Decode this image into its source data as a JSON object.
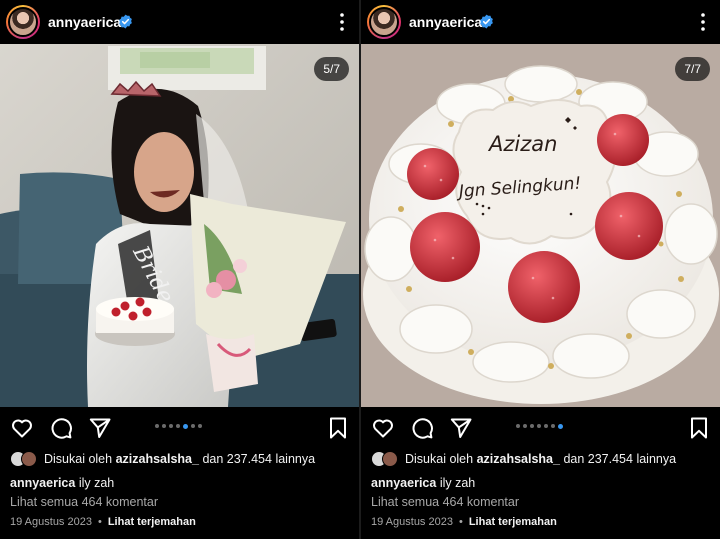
{
  "posts": [
    {
      "username": "annyaerica",
      "counter": "5/7",
      "liked_by_prefix": "Disukai oleh",
      "liked_by_user": "azizahsalsha_",
      "liked_by_suffix": "dan 237.454 lainnya",
      "caption_user": "annyaerica",
      "caption_text": "ily zah",
      "view_comments": "Lihat semua 464 komentar",
      "date": "19 Agustus 2023",
      "separator": "•",
      "translate": "Lihat terjemahan",
      "photo_text": "Bride",
      "carousel": {
        "count": 7,
        "active": 5
      }
    },
    {
      "username": "annyaerica",
      "counter": "7/7",
      "liked_by_prefix": "Disukai oleh",
      "liked_by_user": "azizahsalsha_",
      "liked_by_suffix": "dan 237.454 lainnya",
      "caption_user": "annyaerica",
      "caption_text": "ily zah",
      "view_comments": "Lihat semua 464 komentar",
      "date": "19 Agustus 2023",
      "separator": "•",
      "translate": "Lihat terjemahan",
      "cake_line1": "Azizan",
      "cake_line2": "Jgn Selingkun!",
      "carousel": {
        "count": 7,
        "active": 7
      }
    }
  ],
  "icons": [
    "verified-badge-icon",
    "more-options-icon",
    "heart-icon",
    "comment-icon",
    "share-icon",
    "bookmark-icon"
  ],
  "colors": {
    "background": "#000000",
    "verified": "#3897f0",
    "muted_text": "#a8a8a8",
    "active_dot": "#3897f0"
  }
}
